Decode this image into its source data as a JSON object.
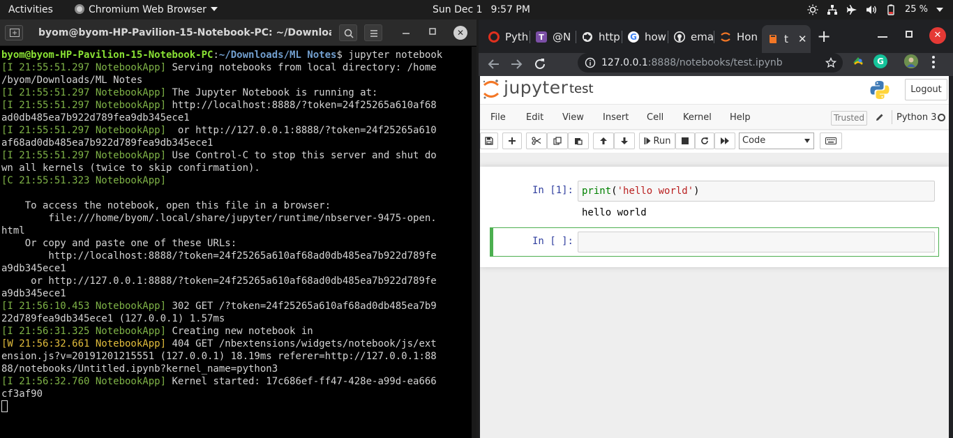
{
  "topbar": {
    "activities": "Activities",
    "app_name": "Chromium Web Browser",
    "date": "Sun Dec 1",
    "time": "9:57 PM",
    "battery": "25 %",
    "tray_icons": [
      "brightness-icon",
      "network-icon",
      "airplane-icon",
      "volume-icon",
      "battery-icon"
    ]
  },
  "terminal": {
    "title": "byom@byom-HP-Pavilion-15-Notebook-PC: ~/Download...",
    "prompt_user": "byom@byom-HP-Pavilion-15-Notebook-PC",
    "prompt_path": "~/Downloads/ML Notes",
    "command": "jupyter notebook",
    "lines": [
      {
        "tag": "[I 21:55:51.297 NotebookApp]",
        "text": " Serving notebooks from local directory: /home\n/byom/Downloads/ML Notes",
        "kind": "info"
      },
      {
        "tag": "[I 21:55:51.297 NotebookApp]",
        "text": " The Jupyter Notebook is running at:",
        "kind": "info"
      },
      {
        "tag": "[I 21:55:51.297 NotebookApp]",
        "text": " http://localhost:8888/?token=24f25265a610af68\nad0db485ea7b922d789fea9db345ece1",
        "kind": "info"
      },
      {
        "tag": "[I 21:55:51.297 NotebookApp]",
        "text": "  or http://127.0.0.1:8888/?token=24f25265a610\naf68ad0db485ea7b922d789fea9db345ece1",
        "kind": "info"
      },
      {
        "tag": "[I 21:55:51.297 NotebookApp]",
        "text": " Use Control-C to stop this server and shut do\nwn all kernels (twice to skip confirmation).",
        "kind": "info"
      },
      {
        "tag": "[C 21:55:51.323 NotebookApp]",
        "text": "\n\n    To access the notebook, open this file in a browser:\n        file:///home/byom/.local/share/jupyter/runtime/nbserver-9475-open.\nhtml\n    Or copy and paste one of these URLs:\n        http://localhost:8888/?token=24f25265a610af68ad0db485ea7b922d789fe\na9db345ece1\n     or http://127.0.0.1:8888/?token=24f25265a610af68ad0db485ea7b922d789fe\na9db345ece1",
        "kind": "critical"
      },
      {
        "tag": "[I 21:56:10.453 NotebookApp]",
        "text": " 302 GET /?token=24f25265a610af68ad0db485ea7b9\n22d789fea9db345ece1 (127.0.0.1) 1.57ms",
        "kind": "info"
      },
      {
        "tag": "[I 21:56:31.325 NotebookApp]",
        "text": " Creating new notebook in",
        "kind": "info"
      },
      {
        "tag": "[W 21:56:32.661 NotebookApp]",
        "text": " 404 GET /nbextensions/widgets/notebook/js/ext\nension.js?v=20191201215551 (127.0.0.1) 18.19ms referer=http://127.0.0.1:88\n88/notebooks/Untitled.ipynb?kernel_name=python3",
        "kind": "warn"
      },
      {
        "tag": "[I 21:56:32.760 NotebookApp]",
        "text": " Kernel started: 17c686ef-ff47-428e-a99d-ea666\ncf3af90",
        "kind": "info"
      }
    ]
  },
  "browser": {
    "tabs": [
      {
        "label": "Pyth",
        "icon": "opera-icon",
        "color": "#e0301e"
      },
      {
        "label": "@N",
        "icon": "teams-icon",
        "color": "#7b4fa6"
      },
      {
        "label": "http",
        "icon": "globe-icon",
        "color": "#e8e8e8"
      },
      {
        "label": "how",
        "icon": "google-icon",
        "color": "#4285f4"
      },
      {
        "label": "ema",
        "icon": "github-icon",
        "color": "#e8e8e8"
      },
      {
        "label": "Hon",
        "icon": "jupyter-icon",
        "color": "#f37726"
      },
      {
        "label": "t",
        "icon": "notebook-icon",
        "color": "#f37726"
      }
    ],
    "url_host": "127.0.0.1",
    "url_rest": ":8888/notebooks/test.ipynb"
  },
  "jupyter": {
    "brand": "jupyter",
    "notebook_name": "test",
    "logout": "Logout",
    "menus": [
      "File",
      "Edit",
      "View",
      "Insert",
      "Cell",
      "Kernel",
      "Help"
    ],
    "trusted": "Trusted",
    "kernel_name": "Python 3",
    "run_label": "Run",
    "cell_type": "Code",
    "cells": [
      {
        "prompt": "In [1]:",
        "code_builtin": "print",
        "code_open": "(",
        "code_string": "'hello world'",
        "code_close": ")",
        "output": "hello world"
      },
      {
        "prompt": "In [ ]:",
        "code": ""
      }
    ]
  }
}
